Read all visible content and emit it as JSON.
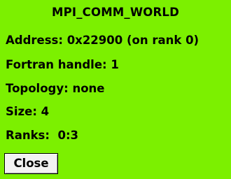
{
  "window": {
    "title": "MPI_COMM_WORLD",
    "background_color": "#7cf000"
  },
  "info": {
    "address": "Address: 0x22900 (on rank 0)",
    "fortran_handle": "Fortran handle: 1",
    "topology": "Topology: none",
    "size": "Size: 4",
    "ranks": "Ranks:  0:3"
  },
  "actions": {
    "close_label": "Close"
  }
}
